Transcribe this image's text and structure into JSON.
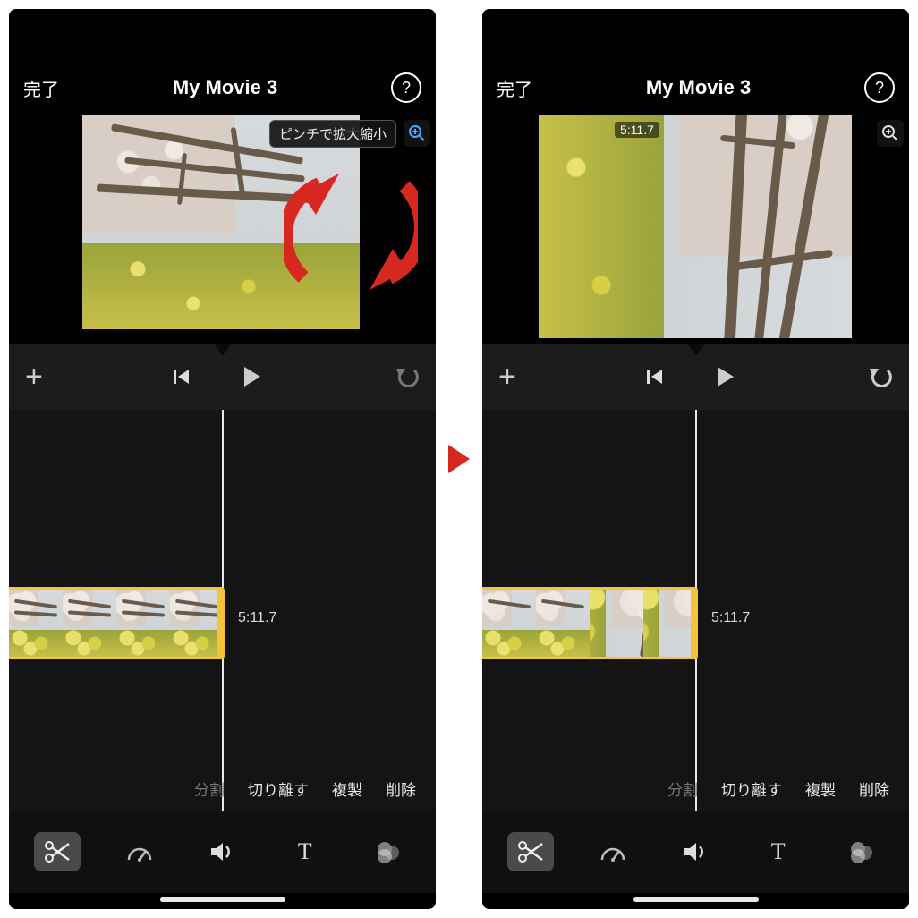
{
  "header": {
    "done_label": "完了",
    "title": "My Movie 3",
    "help_glyph": "?"
  },
  "preview": {
    "pinch_tooltip": "ピンチで拡大縮小",
    "time_badge": "5:11.7"
  },
  "timeline": {
    "clip_time_label": "5:11.7"
  },
  "edit_actions": {
    "split": "分割",
    "detach": "切り離す",
    "duplicate": "複製",
    "delete": "削除"
  },
  "toolbar": {
    "scissors": "scissors",
    "speed": "speed",
    "volume": "volume",
    "text": "T",
    "filter": "filter"
  },
  "colors": {
    "accent_yellow": "#f3c33c",
    "annotation_red": "#d6281f"
  }
}
